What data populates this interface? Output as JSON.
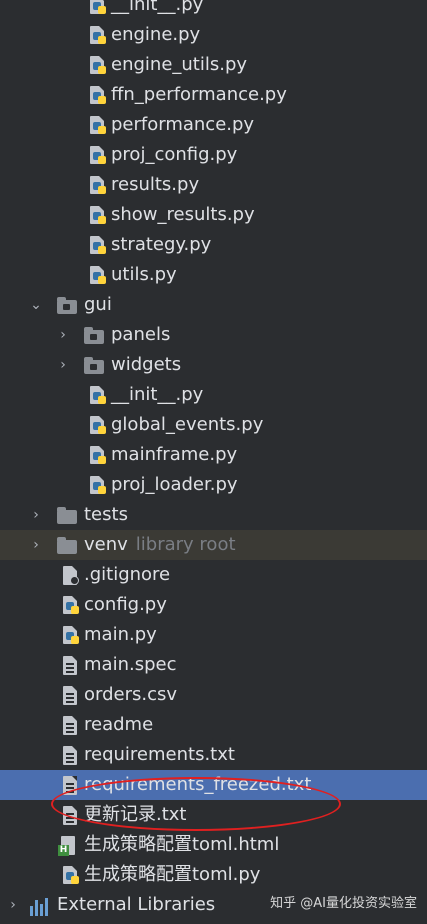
{
  "tree": {
    "engine_files": [
      "__init__.py",
      "engine.py",
      "engine_utils.py",
      "ffn_performance.py",
      "performance.py",
      "proj_config.py",
      "results.py",
      "show_results.py",
      "strategy.py",
      "utils.py"
    ],
    "gui_folder": "gui",
    "gui_subfolders": [
      "panels",
      "widgets"
    ],
    "gui_files": [
      "__init__.py",
      "global_events.py",
      "mainframe.py",
      "proj_loader.py"
    ],
    "tests_folder": "tests",
    "venv_folder": "venv",
    "venv_hint": "library root",
    "root_files": [
      ".gitignore",
      "config.py",
      "main.py",
      "main.spec",
      "orders.csv",
      "readme",
      "requirements.txt",
      "requirements_freezed.txt",
      "更新记录.txt",
      "生成策略配置toml.html",
      "生成策略配置toml.py"
    ],
    "external_libraries": "External Libraries"
  },
  "watermark": "知乎 @AI量化投资实验室",
  "colors": {
    "background": "#2b2d30",
    "selection": "#4b6eaf",
    "annotation": "#e02020"
  }
}
